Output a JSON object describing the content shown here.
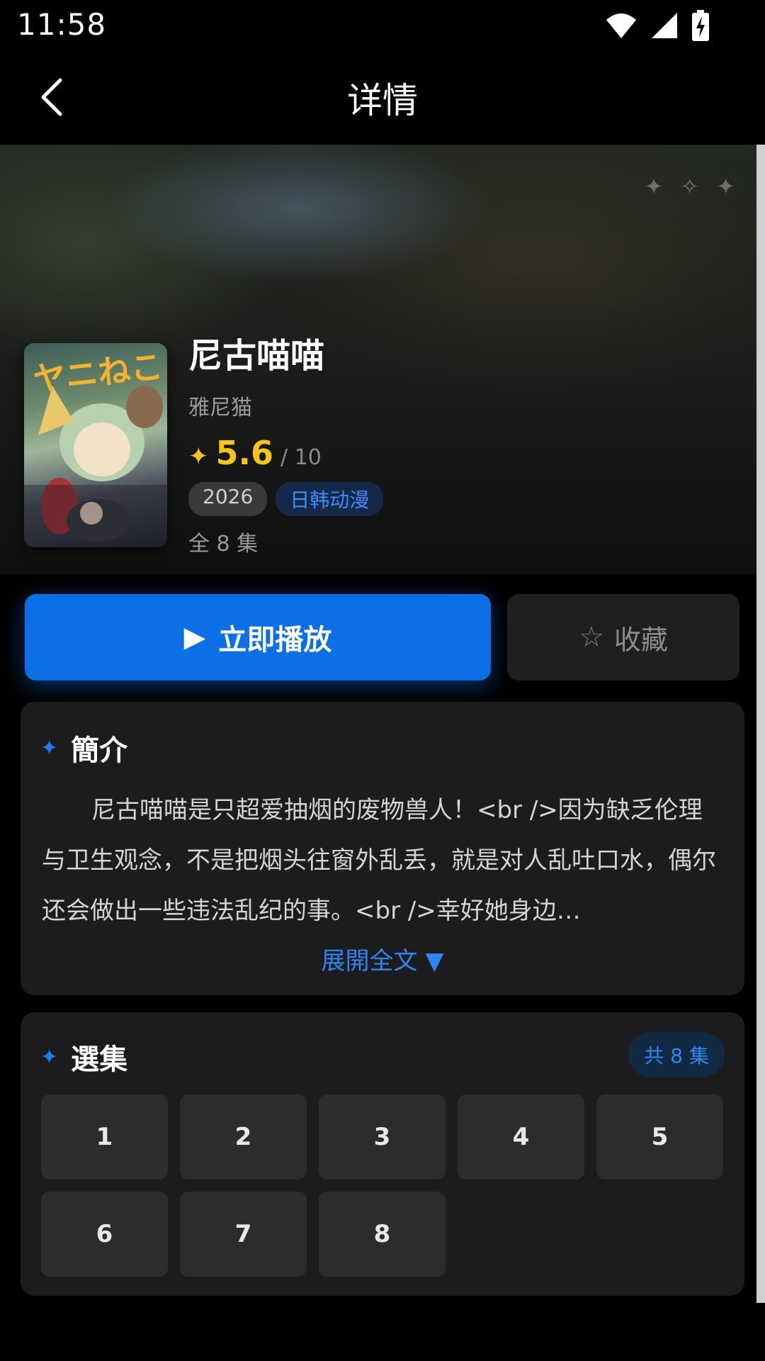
{
  "status_bar": {
    "time": "11:58",
    "icons": [
      "wifi-icon",
      "cell-signal-icon",
      "battery-charging-icon"
    ]
  },
  "header": {
    "title": "详情",
    "back_icon": "chevron-left-icon"
  },
  "hero": {
    "sparkles": [
      "✦",
      "✧",
      "✦"
    ],
    "poster_text": "ヤニねこ",
    "title": "尼古喵喵",
    "subtitle": "雅尼猫",
    "rating": {
      "star": "✦",
      "value": "5.6",
      "max": "/ 10"
    },
    "tags": {
      "year": "2026",
      "genre": "日韩动漫"
    },
    "episodes_total": "全 8 集"
  },
  "actions": {
    "play_icon": "▶",
    "play_label": "立即播放",
    "favorite_icon": "☆",
    "favorite_label": "收藏"
  },
  "intro": {
    "icon": "✦",
    "title": "簡介",
    "text": "尼古喵喵是只超爱抽烟的废物兽人！<br />因为缺乏伦理与卫生观念，不是把烟头往窗外乱丢，就是对人乱吐口水，偶尔还会做出一些违法乱纪的事。<br />幸好她身边…",
    "expand_label": "展開全文 ▼"
  },
  "episodes": {
    "icon": "✦",
    "title": "選集",
    "count_label": "共 8 集",
    "items": [
      "1",
      "2",
      "3",
      "4",
      "5",
      "6",
      "7",
      "8"
    ]
  },
  "colors": {
    "accent": "#0d6fe6",
    "rating": "#f5c518",
    "card_bg": "#1c1c1e",
    "episode_bg": "#2c2c2e"
  }
}
